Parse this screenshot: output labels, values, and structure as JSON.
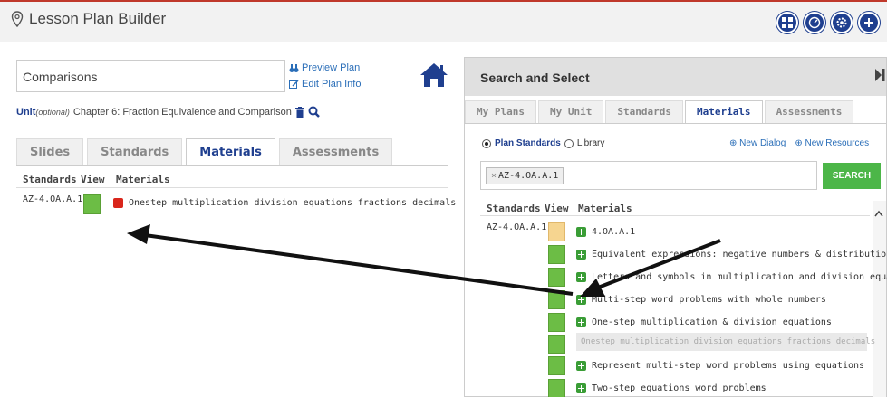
{
  "header": {
    "title": "Lesson Plan Builder",
    "icons": [
      "grid-icon",
      "gauge-icon",
      "gear-icon",
      "plus-icon"
    ]
  },
  "plan": {
    "name": "Comparisons",
    "preview_label": "Preview Plan",
    "edit_label": "Edit Plan Info",
    "unit_label": "Unit",
    "unit_optional": "(optional)",
    "unit_value": "Chapter 6: Fraction Equivalence and Comparison"
  },
  "left_tabs": [
    "Slides",
    "Standards",
    "Materials",
    "Assessments"
  ],
  "left_active_tab": "Materials",
  "left_columns": [
    "Standards",
    "View",
    "Materials"
  ],
  "left_rows": [
    {
      "standard": "AZ-4.OA.A.1",
      "material": "Onestep multiplication division equations fractions decimals"
    }
  ],
  "search": {
    "title": "Search and Select",
    "tabs": [
      "My Plans",
      "My Unit",
      "Standards",
      "Materials",
      "Assessments"
    ],
    "active_tab": "Materials",
    "radio_plan": "Plan Standards",
    "radio_library": "Library",
    "new_dialog": "New Dialog",
    "new_resources": "New Resources",
    "chip": "AZ-4.OA.A.1",
    "button": "SEARCH",
    "columns": [
      "Standards",
      "View",
      "Materials"
    ],
    "standard": "AZ-4.OA.A.1",
    "materials": [
      "4.OA.A.1",
      "Equivalent expressions: negative numbers & distribution",
      "Letters and symbols in multiplication and division equations",
      "Multi-step word problems with whole numbers",
      "One-step multiplication & division equations",
      "Onestep multiplication division equations fractions decimals",
      "Represent multi-step word problems using equations",
      "Two-step equations word problems"
    ]
  },
  "colors": {
    "accent_blue": "#1f3f8f",
    "add_green": "#3a9d36",
    "remove_red": "#d9261c",
    "search_green": "#4cb648"
  }
}
